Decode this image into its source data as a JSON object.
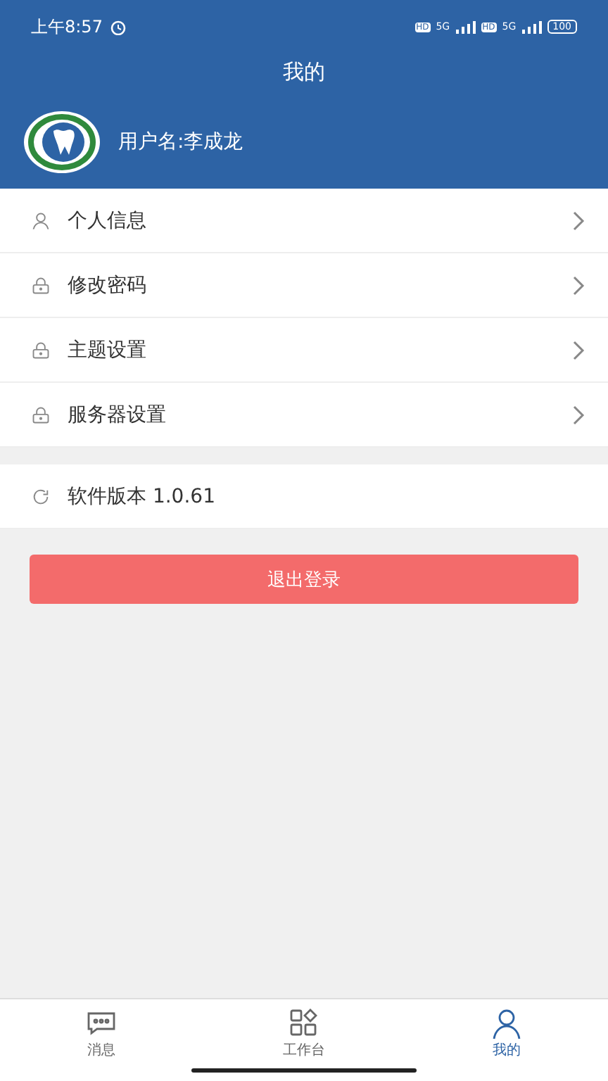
{
  "status_bar": {
    "time": "上午8:57",
    "sims": [
      {
        "hd": "HD",
        "network": "5G"
      },
      {
        "hd": "HD",
        "network": "5G"
      }
    ],
    "battery": "100"
  },
  "title": "我的",
  "user": {
    "name": "用户名:李成龙"
  },
  "menu": [
    {
      "kind": "user",
      "label": "个人信息"
    },
    {
      "kind": "lock",
      "label": "修改密码"
    },
    {
      "kind": "lock",
      "label": "主题设置"
    },
    {
      "kind": "lock",
      "label": "服务器设置"
    }
  ],
  "version": {
    "label": "软件版本 1.0.61"
  },
  "logout": "退出登录",
  "tabs": [
    {
      "kind": "chat",
      "label": "消息",
      "selected": false
    },
    {
      "kind": "grid",
      "label": "工作台",
      "selected": false
    },
    {
      "kind": "user",
      "label": "我的",
      "selected": true
    }
  ]
}
